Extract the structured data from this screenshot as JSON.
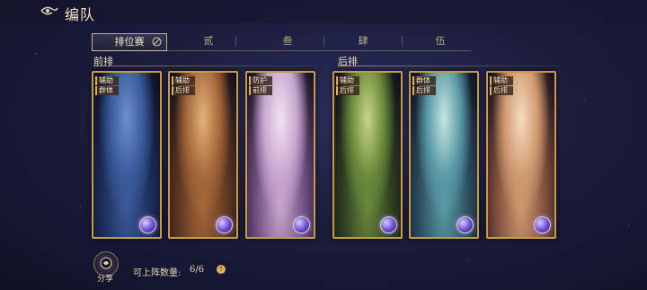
{
  "header": {
    "title": "编队",
    "back_icon": "back-arrow-icon"
  },
  "tabs": [
    {
      "label": "排位赛",
      "active": true
    },
    {
      "label": "贰",
      "active": false
    },
    {
      "label": "叁",
      "active": false
    },
    {
      "label": "肆",
      "active": false
    },
    {
      "label": "伍",
      "active": false
    }
  ],
  "rows": {
    "front": "前排",
    "back": "后排"
  },
  "cards": [
    {
      "grade": "",
      "tags": [
        "辅助",
        "群体"
      ],
      "palette": [
        "#1a2a55",
        "#3a5a9a",
        "#6c8fd0"
      ]
    },
    {
      "grade": "",
      "tags": [
        "辅助",
        "后排"
      ],
      "palette": [
        "#5a3420",
        "#a5683a",
        "#e3b27a"
      ]
    },
    {
      "grade": "",
      "tags": [
        "防护",
        "前排"
      ],
      "palette": [
        "#6a4a7a",
        "#c8a6d0",
        "#f2e2f0"
      ]
    },
    {
      "grade": "",
      "tags": [
        "辅助",
        "后排"
      ],
      "palette": [
        "#2a3a20",
        "#6a8a3a",
        "#c8d68a"
      ]
    },
    {
      "grade": "",
      "tags": [
        "群体",
        "后排"
      ],
      "palette": [
        "#2a4a5a",
        "#5a9aa8",
        "#c6e6e0"
      ]
    },
    {
      "grade": "",
      "tags": [
        "辅助",
        "后排"
      ],
      "palette": [
        "#7a4a3a",
        "#d09a70",
        "#f6dcc0"
      ]
    }
  ],
  "footer": {
    "share_label": "分享",
    "count_label": "可上阵数量:",
    "count_value": "6/6",
    "info_icon": "!"
  }
}
